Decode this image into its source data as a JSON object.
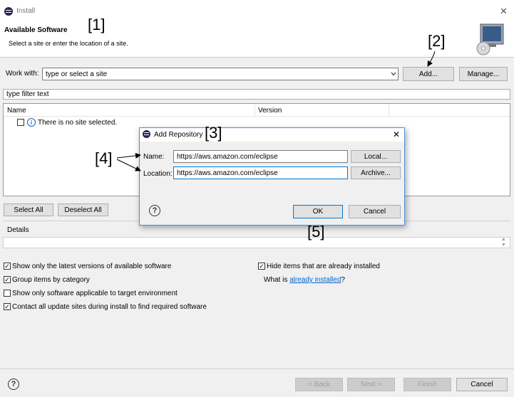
{
  "window": {
    "title": "Install",
    "close_glyph": "✕"
  },
  "header": {
    "title": "Available Software",
    "subtitle": "Select a site or enter the location of a site."
  },
  "work_with": {
    "label": "Work with:",
    "value": "type or select a site",
    "add_label": "Add...",
    "manage_label": "Manage..."
  },
  "filter": {
    "placeholder": "type filter text"
  },
  "table": {
    "columns": [
      "Name",
      "Version"
    ],
    "empty_message": "There is no site selected."
  },
  "buttons": {
    "select_all": "Select All",
    "deselect_all": "Deselect All"
  },
  "details": {
    "label": "Details"
  },
  "options": [
    {
      "label": "Show only the latest versions of available software",
      "checked": true
    },
    {
      "label": "Group items by category",
      "checked": true
    },
    {
      "label": "Show only software applicable to target environment",
      "checked": false
    },
    {
      "label": "Contact all update sites during install to find required software",
      "checked": true
    }
  ],
  "right_options": {
    "hide_installed": {
      "label": "Hide items that are already installed",
      "checked": true
    },
    "what_is_prefix": "What is ",
    "already_installed_link": "already installed",
    "what_is_suffix": "?"
  },
  "footer": {
    "back": "< Back",
    "next": "Next >",
    "finish": "Finish",
    "cancel": "Cancel"
  },
  "dialog": {
    "title": "Add Repository",
    "close_glyph": "✕",
    "name_label": "Name:",
    "name_value": "https://aws.amazon.com/eclipse",
    "location_label": "Location:",
    "location_value": "https://aws.amazon.com/eclipse",
    "local_label": "Local...",
    "archive_label": "Archive...",
    "ok_label": "OK",
    "cancel_label": "Cancel"
  },
  "annotations": {
    "a1": "[1]",
    "a2": "[2]",
    "a3": "[3]",
    "a4": "[4]",
    "a5": "[5]"
  },
  "colors": {
    "link": "#0066cc",
    "dialog_border": "#4a90d9",
    "focus_border": "#0078d7"
  },
  "icons": {
    "window": "eclipse-icon",
    "help": "help-icon",
    "banner": "install-monitor-icon",
    "info": "info-icon"
  }
}
